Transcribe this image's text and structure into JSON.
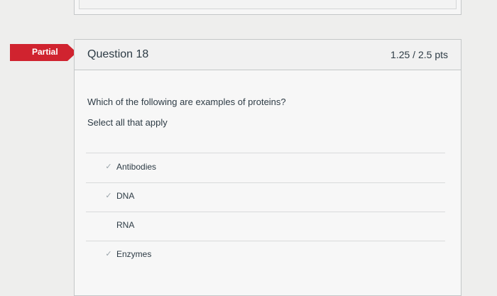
{
  "status_flag": {
    "label": "Partial",
    "color": "#d0232f"
  },
  "question": {
    "title": "Question 18",
    "points": "1.25 / 2.5 pts",
    "text": "Which of the following are examples of proteins?",
    "instruction": "Select all that apply"
  },
  "answers": [
    {
      "label": "Antibodies",
      "selected": true,
      "check_glyph": "✓"
    },
    {
      "label": "DNA",
      "selected": true,
      "check_glyph": "✓"
    },
    {
      "label": "RNA",
      "selected": false,
      "check_glyph": ""
    },
    {
      "label": "Enzymes",
      "selected": true,
      "check_glyph": "✓"
    }
  ],
  "icons": {
    "check": "checkmark-icon",
    "flag": "partial-flag-banner"
  }
}
